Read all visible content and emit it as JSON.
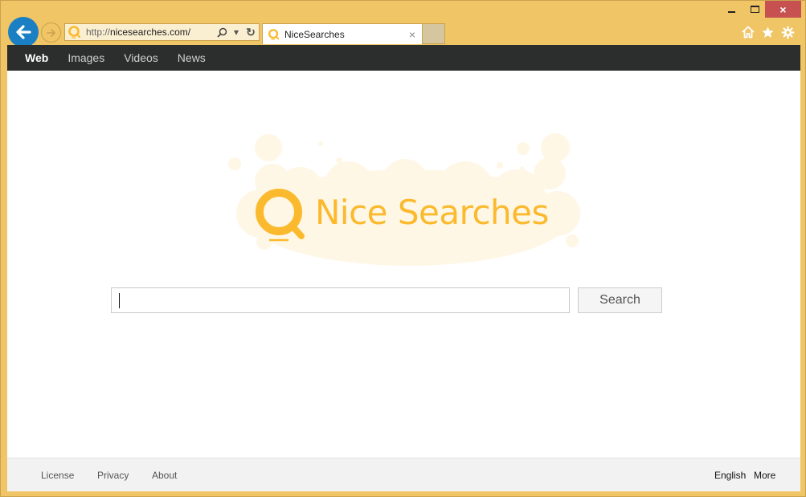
{
  "window": {
    "minimize_label": "Minimize",
    "maximize_label": "Maximize",
    "close_label": "×"
  },
  "browser": {
    "address": {
      "protocol": "http://",
      "domain": "nicesearches.com/",
      "search_icon": "search-icon",
      "dropdown_icon": "▾",
      "refresh_icon": "↻"
    },
    "tab": {
      "title": "NiceSearches",
      "close": "×"
    },
    "toolbar": {
      "home": "home-icon",
      "favorites": "star-icon",
      "settings": "gear-icon"
    }
  },
  "topnav": {
    "items": [
      {
        "label": "Web",
        "active": true
      },
      {
        "label": "Images",
        "active": false
      },
      {
        "label": "Videos",
        "active": false
      },
      {
        "label": "News",
        "active": false
      }
    ]
  },
  "logo": {
    "text": "Nice Searches",
    "color": "#fbb92e",
    "bubble_color": "#fff7e6"
  },
  "search": {
    "value": "",
    "placeholder": "",
    "button_label": "Search"
  },
  "footer": {
    "left_links": [
      "License",
      "Privacy",
      "About"
    ],
    "language": "English",
    "more": "More"
  },
  "colors": {
    "frame": "#f0c566",
    "back_button": "#1b7fc4",
    "nav_bar": "#2c2d2d",
    "close_button": "#c75050",
    "active_underline": "#c81414"
  }
}
